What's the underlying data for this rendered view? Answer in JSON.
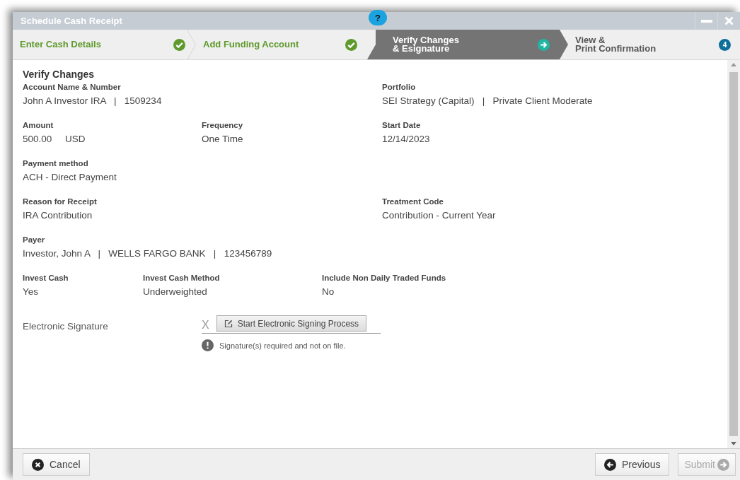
{
  "window": {
    "title": "Schedule Cash Receipt",
    "help": "?"
  },
  "steps": [
    {
      "label": "Enter Cash Details",
      "completed": true,
      "selected": false
    },
    {
      "label": "Add Funding Account",
      "completed": true,
      "selected": false
    },
    {
      "label": "Verify Changes\n& Esignature",
      "completed": false,
      "selected": true
    },
    {
      "label": "View &\nPrint Confirmation",
      "completed": false,
      "selected": false,
      "number": "4"
    }
  ],
  "section_title": "Verify Changes",
  "rows": [
    {
      "kind": "wide",
      "fields": [
        {
          "label": "Account Name & Number",
          "value": "John A Investor IRA   |   1509234"
        },
        {
          "label": "Portfolio",
          "value": "SEI Strategy (Capital)   |   Private Client Moderate"
        }
      ]
    },
    {
      "kind": "thirds",
      "fields": [
        {
          "label": "Amount",
          "value": "500.00     USD"
        },
        {
          "label": "Frequency",
          "value": "One Time"
        },
        {
          "label": "Start Date",
          "value": "12/14/2023"
        }
      ]
    },
    {
      "kind": "wide",
      "fields": [
        {
          "label": "Payment method",
          "value": "ACH - Direct Payment"
        }
      ]
    },
    {
      "kind": "wide",
      "fields": [
        {
          "label": "Reason for Receipt",
          "value": "IRA Contribution"
        },
        {
          "label": "Treatment Code",
          "value": "Contribution - Current Year"
        }
      ]
    },
    {
      "kind": "wide",
      "fields": [
        {
          "label": "Payer",
          "value": "Investor, John A   |   WELLS FARGO BANK   |   123456789"
        }
      ]
    },
    {
      "kind": "compact",
      "fields": [
        {
          "label": "Invest Cash",
          "value": "Yes"
        },
        {
          "label": "Invest Cash Method",
          "value": "Underweighted"
        },
        {
          "label": "Include Non Daily Traded Funds",
          "value": "No"
        }
      ]
    }
  ],
  "signature": {
    "label": "Electronic Signature",
    "mark": "X",
    "button": "Start Electronic Signing Process",
    "warning": "Signature(s) required and not on file."
  },
  "footer": {
    "cancel": "Cancel",
    "previous": "Previous",
    "submit": "Submit",
    "submit_disabled": true
  }
}
